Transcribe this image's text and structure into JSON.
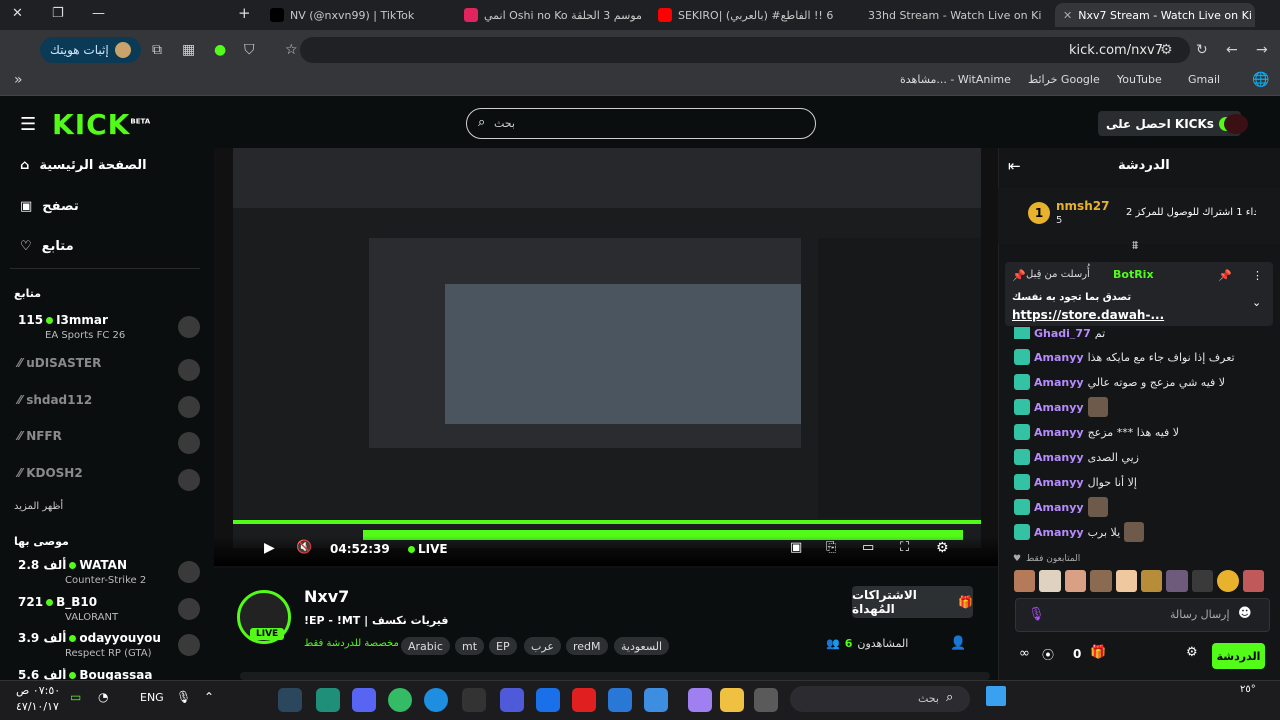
{
  "browser": {
    "tabs": [
      {
        "title": "NV (@nxvn99) | TikTok",
        "color": "#000000"
      },
      {
        "title": "انمي Oshi no Ko الموسم 3 الحلقة",
        "color": "#e0245e"
      },
      {
        "title": "SEKIRO| (بالعربي) #6 !! الفاطع",
        "color": "#ff0000"
      },
      {
        "title": "33hd Stream - Watch Live on Ki",
        "color": "#53fc18"
      },
      {
        "title": "Nxv7 Stream - Watch Live on Ki",
        "color": "#53fc18"
      }
    ],
    "identity_label": "إثبات هويتك",
    "url": "kick.com/nxv7",
    "bookmarks": [
      "Gmail",
      "YouTube",
      "خرائط Google",
      "مشاهدة... - WitAnime"
    ]
  },
  "header": {
    "logo": "KICK",
    "logo_badge": "BETA",
    "search_placeholder": "بحث",
    "kicks_button": "احصل على KICKs"
  },
  "sidebar": {
    "nav": [
      "الصفحة الرئيسية",
      "تصفح",
      "متابع"
    ],
    "following_title": "متابع",
    "following": [
      {
        "name": "I3mmar",
        "viewers": "115",
        "game": "EA Sports FC 26",
        "live": true
      },
      {
        "name": "uDISASTER",
        "viewers": "",
        "game": "",
        "live": false
      },
      {
        "name": "shdad112",
        "viewers": "",
        "game": "",
        "live": false
      },
      {
        "name": "NFFR",
        "viewers": "",
        "game": "",
        "live": false
      },
      {
        "name": "KDOSH2",
        "viewers": "",
        "game": "",
        "live": false
      }
    ],
    "show_more": "أظهر المزيد",
    "recommended_title": "موصى بها",
    "recommended": [
      {
        "name": "WATAN",
        "viewers": "2.8 ألف",
        "game": "Counter-Strike 2"
      },
      {
        "name": "B_B10",
        "viewers": "721",
        "game": "VALORANT"
      },
      {
        "name": "odayyouyou",
        "viewers": "3.9 ألف",
        "game": "Respect RP (GTA)"
      },
      {
        "name": "Bougassaa",
        "viewers": "5.6 ألف",
        "game": ""
      }
    ]
  },
  "player": {
    "time": "04:52:39",
    "live_label": "LIVE"
  },
  "stream": {
    "streamer": "Nxv7",
    "title": "!EP - !MT | فيريات نكسف",
    "chat_mode": "مخصصة للدردشة فقط",
    "tags": [
      "Arabic",
      "mt",
      "EP",
      "عرب",
      "redM",
      "السعودية"
    ],
    "viewers_label": "المشاهدون",
    "viewers": "6",
    "sub_button": "الاشتراكات المُهداة",
    "live_badge": "LIVE"
  },
  "chat": {
    "title": "الدردشة",
    "leader": {
      "name": "nmsh27",
      "count": "5",
      "rank": "1",
      "text": "إهداء 1 اشتراك للوصول للمركز 2"
    },
    "pinned": {
      "user": "BotRix",
      "header": "أُرسلت من قِبل",
      "text": "تصدق بما تجود به نفسك",
      "link": "https://store.dawah-..."
    },
    "messages": [
      {
        "user": "Ghadi_77",
        "text": "تم"
      },
      {
        "user": "Amanyy",
        "text": "تعرف إذا نواف جاء مع مايكه هذا"
      },
      {
        "user": "Amanyy",
        "text": "لا فيه شي مزعج و صوته عالي"
      },
      {
        "user": "Amanyy",
        "text": ""
      },
      {
        "user": "Amanyy",
        "text": "لا فيه هذا *** مزعج"
      },
      {
        "user": "Amanyy",
        "text": "زيي الصدى"
      },
      {
        "user": "Amanyy",
        "text": "إلا أنا حوال"
      },
      {
        "user": "Amanyy",
        "text": ""
      },
      {
        "user": "Amanyy",
        "text": "يلا برب"
      }
    ],
    "followers_only": "المتابعون فقط",
    "input_placeholder": "إرسال رسالة",
    "points": "0",
    "send_button": "الدردشة"
  },
  "taskbar": {
    "search": "بحث",
    "lang": "ENG",
    "time": "٠٧:٥٠ ص",
    "date": "٤٧/١٠/١٧",
    "temp": "٢٥°"
  }
}
